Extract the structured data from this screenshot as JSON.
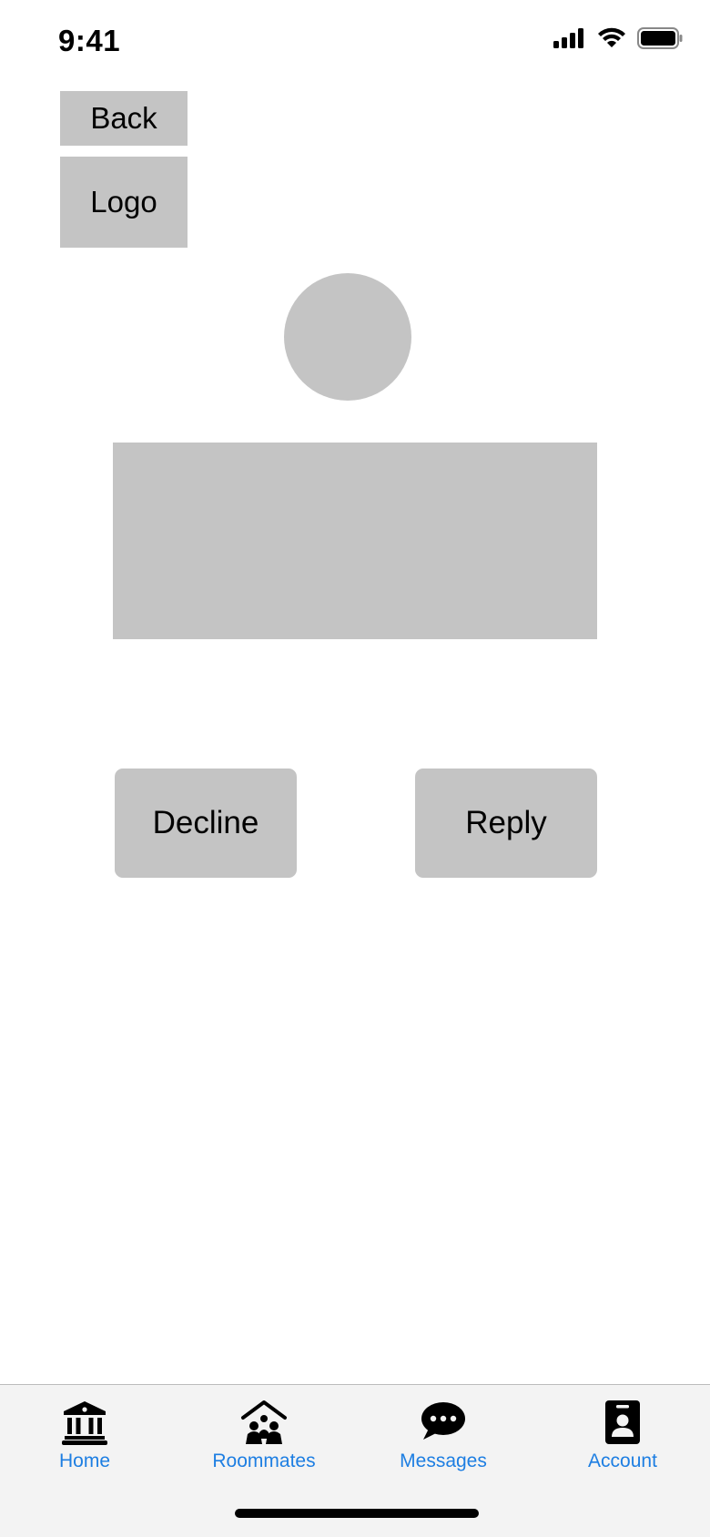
{
  "status_bar": {
    "time": "9:41"
  },
  "header": {
    "back_label": "Back",
    "logo_label": "Logo"
  },
  "actions": {
    "decline_label": "Decline",
    "reply_label": "Reply"
  },
  "tabbar": {
    "accent": "#1d7ee2",
    "items": [
      {
        "label": "Home",
        "icon": "bank-icon"
      },
      {
        "label": "Roommates",
        "icon": "house-people-icon"
      },
      {
        "label": "Messages",
        "icon": "chat-bubble-icon"
      },
      {
        "label": "Account",
        "icon": "id-card-icon"
      }
    ]
  }
}
